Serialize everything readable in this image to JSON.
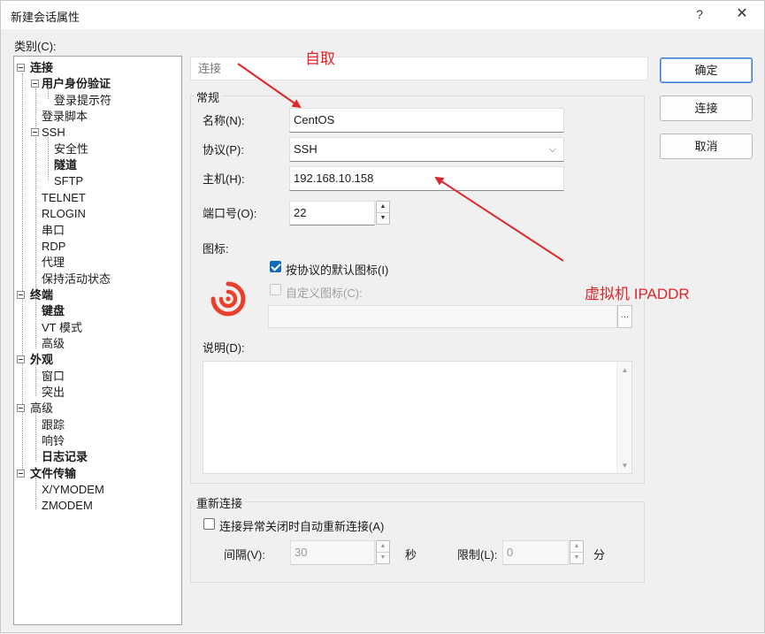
{
  "window": {
    "title": "新建会话属性",
    "help_glyph": "?",
    "close_glyph": "✕"
  },
  "category_label": "类别(C):",
  "tree": [
    {
      "label": "连接",
      "bold": true
    },
    {
      "label": "用户身份验证",
      "bold": true
    },
    {
      "label": "登录提示符",
      "bold": false
    },
    {
      "label": "登录脚本",
      "bold": false
    },
    {
      "label": "SSH",
      "bold": false
    },
    {
      "label": "安全性",
      "bold": false
    },
    {
      "label": "隧道",
      "bold": true
    },
    {
      "label": "SFTP",
      "bold": false
    },
    {
      "label": "TELNET",
      "bold": false
    },
    {
      "label": "RLOGIN",
      "bold": false
    },
    {
      "label": "串口",
      "bold": false
    },
    {
      "label": "RDP",
      "bold": false
    },
    {
      "label": "代理",
      "bold": false
    },
    {
      "label": "保持活动状态",
      "bold": false
    },
    {
      "label": "终端",
      "bold": true
    },
    {
      "label": "键盘",
      "bold": true
    },
    {
      "label": "VT 模式",
      "bold": false
    },
    {
      "label": "高级",
      "bold": false
    },
    {
      "label": "外观",
      "bold": true
    },
    {
      "label": "窗口",
      "bold": false
    },
    {
      "label": "突出",
      "bold": false
    },
    {
      "label": "高级",
      "bold": false
    },
    {
      "label": "跟踪",
      "bold": false
    },
    {
      "label": "响铃",
      "bold": false
    },
    {
      "label": "日志记录",
      "bold": true
    },
    {
      "label": "文件传输",
      "bold": true
    },
    {
      "label": "X/YMODEM",
      "bold": false
    },
    {
      "label": "ZMODEM",
      "bold": false
    }
  ],
  "panel_header": "连接",
  "general": {
    "group_label": "常规",
    "name_label": "名称(N):",
    "name_value": "CentOS",
    "protocol_label": "协议(P):",
    "protocol_value": "SSH",
    "host_label": "主机(H):",
    "host_value": "192.168.10.158",
    "port_label": "端口号(O):",
    "port_value": "22",
    "icon_label": "图标:",
    "default_icon_label": "按协议的默认图标(I)",
    "custom_icon_label": "自定义图标(C):",
    "browse_label": "...",
    "desc_label": "说明(D):"
  },
  "reconnect": {
    "group_label": "重新连接",
    "checkbox_label": "连接异常关闭时自动重新连接(A)",
    "interval_label": "间隔(V):",
    "interval_value": "30",
    "interval_unit": "秒",
    "limit_label": "限制(L):",
    "limit_value": "0",
    "limit_unit": "分"
  },
  "buttons": {
    "ok": "确定",
    "connect": "连接",
    "cancel": "取消"
  },
  "annotations": {
    "self_pick": "自取",
    "vm_ip": "虚拟机 IPADDR"
  },
  "colors": {
    "annotation": "#e0262a",
    "checkbox_accent": "#0f6cbd",
    "app_icon": "#e8402c"
  }
}
